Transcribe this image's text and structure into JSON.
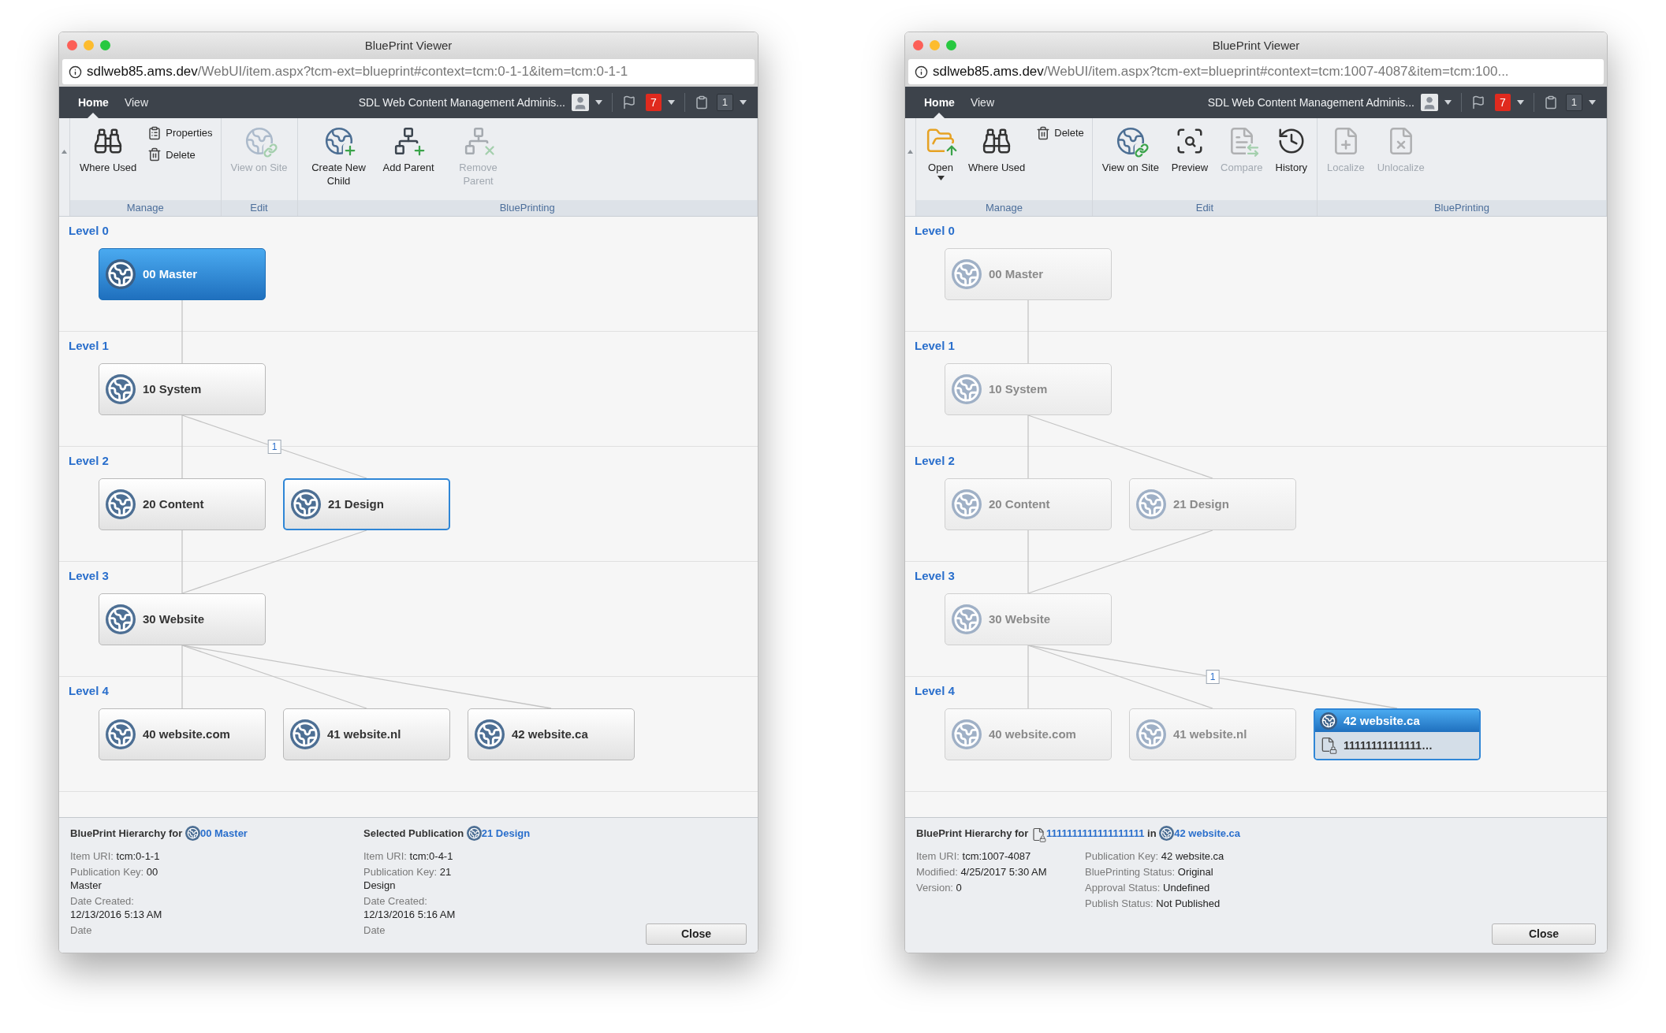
{
  "windows": [
    {
      "title": "BluePrint Viewer",
      "url": {
        "host": "sdlweb85.ams.dev",
        "path": "/WebUI/item.aspx?tcm-ext=blueprint#context=tcm:0-1-1&item=tcm:0-1-1"
      },
      "nav": {
        "tabs": [
          {
            "label": "Home",
            "selected": true
          },
          {
            "label": "View",
            "selected": false
          }
        ],
        "user": "SDL Web Content Management Adminis...",
        "notifications": "7",
        "clipboard": "1"
      },
      "ribbon": [
        {
          "label": "Manage",
          "buttons": [
            {
              "label": "Where Used",
              "kind": "large",
              "disabled": false,
              "dropdown": false
            },
            {
              "label": "Properties",
              "kind": "small",
              "disabled": false,
              "dropdown": false
            },
            {
              "label": "Delete",
              "kind": "small",
              "disabled": false,
              "dropdown": false
            }
          ]
        },
        {
          "label": "Edit",
          "buttons": [
            {
              "label": "View on Site",
              "kind": "large",
              "disabled": true,
              "dropdown": false
            }
          ]
        },
        {
          "label": "BluePrinting",
          "buttons": [
            {
              "label": "Create New Child",
              "kind": "large",
              "disabled": false,
              "dropdown": false
            },
            {
              "label": "Add Parent",
              "kind": "large",
              "disabled": false,
              "dropdown": false
            },
            {
              "label": "Remove Parent",
              "kind": "large",
              "disabled": true,
              "dropdown": false
            }
          ]
        }
      ],
      "levels": [
        {
          "label": "Level 0",
          "nodes": [
            {
              "name": "00 Master",
              "highlighted": true,
              "selected": false,
              "dimmed": false
            }
          ]
        },
        {
          "label": "Level 1",
          "nodes": [
            {
              "name": "10 System",
              "highlighted": false,
              "selected": false,
              "dimmed": false
            }
          ]
        },
        {
          "label": "Level 2",
          "nodes": [
            {
              "name": "20 Content",
              "highlighted": false,
              "selected": false,
              "dimmed": false
            },
            {
              "name": "21 Design",
              "highlighted": false,
              "selected": true,
              "dimmed": false,
              "link_badge": "1"
            }
          ]
        },
        {
          "label": "Level 3",
          "nodes": [
            {
              "name": "30 Website",
              "highlighted": false,
              "selected": false,
              "dimmed": false
            }
          ]
        },
        {
          "label": "Level 4",
          "nodes": [
            {
              "name": "40 website.com",
              "highlighted": false,
              "selected": false,
              "dimmed": false
            },
            {
              "name": "41 website.nl",
              "highlighted": false,
              "selected": false,
              "dimmed": false
            },
            {
              "name": "42 website.ca",
              "highlighted": false,
              "selected": false,
              "dimmed": false
            }
          ]
        }
      ],
      "info": {
        "sections": [
          {
            "heading": "BluePrint Hierarchy for",
            "parts": [
              {
                "kind": "publication",
                "text": "00 Master"
              }
            ],
            "columns": [
              [
                {
                  "label": "Item URI:",
                  "value": "tcm:0-1-1"
                },
                {
                  "label": "Publication Key:",
                  "value": "00 Master"
                },
                {
                  "label": "Date Created:",
                  "value": "12/13/2016 5:13 AM"
                },
                {
                  "label": "Date"
                }
              ]
            ]
          },
          {
            "heading": "Selected Publication",
            "parts": [
              {
                "kind": "publication",
                "text": "21 Design"
              }
            ],
            "columns": [
              [
                {
                  "label": "Item URI:",
                  "value": "tcm:0-4-1"
                },
                {
                  "label": "Publication Key:",
                  "value": "21 Design"
                },
                {
                  "label": "Date Created:",
                  "value": "12/13/2016 5:16 AM"
                },
                {
                  "label": "Date"
                }
              ]
            ]
          }
        ],
        "close": "Close"
      }
    },
    {
      "title": "BluePrint Viewer",
      "url": {
        "host": "sdlweb85.ams.dev",
        "path": "/WebUI/item.aspx?tcm-ext=blueprint#context=tcm:1007-4087&item=tcm:100..."
      },
      "nav": {
        "tabs": [
          {
            "label": "Home",
            "selected": true
          },
          {
            "label": "View",
            "selected": false
          }
        ],
        "user": "SDL Web Content Management Adminis...",
        "notifications": "7",
        "clipboard": "1"
      },
      "ribbon": [
        {
          "label": "Manage",
          "buttons": [
            {
              "label": "Open",
              "kind": "large",
              "disabled": false,
              "dropdown": true
            },
            {
              "label": "Where Used",
              "kind": "large",
              "disabled": false,
              "dropdown": false
            },
            {
              "label": "Delete",
              "kind": "small",
              "disabled": false,
              "dropdown": false
            }
          ]
        },
        {
          "label": "Edit",
          "buttons": [
            {
              "label": "View on Site",
              "kind": "large",
              "disabled": false,
              "dropdown": false
            },
            {
              "label": "Preview",
              "kind": "large",
              "disabled": false,
              "dropdown": false
            },
            {
              "label": "Compare",
              "kind": "large",
              "disabled": true,
              "dropdown": false
            },
            {
              "label": "History",
              "kind": "large",
              "disabled": false,
              "dropdown": false
            }
          ]
        },
        {
          "label": "BluePrinting",
          "buttons": [
            {
              "label": "Localize",
              "kind": "large",
              "disabled": true,
              "dropdown": false
            },
            {
              "label": "Unlocalize",
              "kind": "large",
              "disabled": true,
              "dropdown": false
            }
          ]
        }
      ],
      "levels": [
        {
          "label": "Level 0",
          "nodes": [
            {
              "name": "00 Master",
              "highlighted": false,
              "selected": false,
              "dimmed": true
            }
          ]
        },
        {
          "label": "Level 1",
          "nodes": [
            {
              "name": "10 System",
              "highlighted": false,
              "selected": false,
              "dimmed": true
            }
          ]
        },
        {
          "label": "Level 2",
          "nodes": [
            {
              "name": "20 Content",
              "highlighted": false,
              "selected": false,
              "dimmed": true
            },
            {
              "name": "21 Design",
              "highlighted": false,
              "selected": false,
              "dimmed": true
            }
          ]
        },
        {
          "label": "Level 3",
          "nodes": [
            {
              "name": "30 Website",
              "highlighted": false,
              "selected": false,
              "dimmed": true
            }
          ]
        },
        {
          "label": "Level 4",
          "nodes": [
            {
              "name": "40 website.com",
              "highlighted": false,
              "selected": false,
              "dimmed": true
            },
            {
              "name": "41 website.nl",
              "highlighted": false,
              "selected": false,
              "dimmed": true
            },
            {
              "name": "42 website.ca",
              "highlighted": false,
              "selected": true,
              "dimmed": false,
              "item": "11111111111111…",
              "link_badge": "1"
            }
          ]
        }
      ],
      "info": {
        "sections": [
          {
            "heading": "BluePrint Hierarchy for",
            "parts": [
              {
                "kind": "item",
                "text": "1111111111111111111"
              },
              {
                "kind": "word",
                "text": "in"
              },
              {
                "kind": "publication",
                "text": "42 website.ca"
              }
            ],
            "columns": [
              [
                {
                  "label": "Item URI:",
                  "value": "tcm:1007-4087"
                },
                {
                  "label": "Modified:",
                  "value": "4/25/2017 5:30 AM"
                },
                {
                  "label": "Version:",
                  "value": "0"
                }
              ],
              [
                {
                  "label": "Publication Key:",
                  "value": "42 website.ca"
                },
                {
                  "label": "BluePrinting Status:",
                  "value": "Original"
                },
                {
                  "label": "Approval Status:",
                  "value": "Undefined"
                },
                {
                  "label": "Publish Status:",
                  "value": "Not Published"
                }
              ]
            ]
          }
        ],
        "close": "Close"
      }
    }
  ]
}
